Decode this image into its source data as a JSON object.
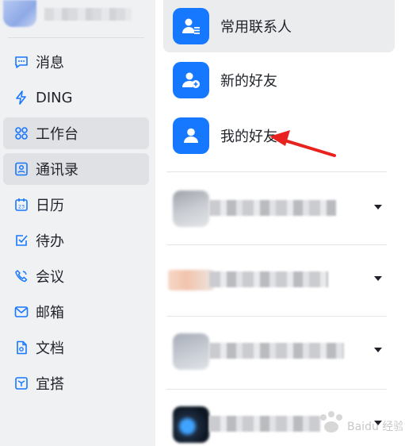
{
  "sidebar": {
    "items": [
      {
        "label": "消息",
        "icon": "chat-bubble-icon"
      },
      {
        "label": "DING",
        "icon": "lightning-icon"
      },
      {
        "label": "工作台",
        "icon": "grid-apps-icon"
      },
      {
        "label": "通讯录",
        "icon": "contacts-book-icon"
      },
      {
        "label": "日历",
        "icon": "calendar-icon",
        "icon_text": "23"
      },
      {
        "label": "待办",
        "icon": "checkbox-icon"
      },
      {
        "label": "会议",
        "icon": "phone-meeting-icon"
      },
      {
        "label": "邮箱",
        "icon": "mail-icon"
      },
      {
        "label": "文档",
        "icon": "document-icon"
      },
      {
        "label": "宜搭",
        "icon": "box-icon"
      }
    ]
  },
  "contacts": {
    "entries": [
      {
        "label": "常用联系人",
        "icon": "frequent-contacts-icon"
      },
      {
        "label": "新的好友",
        "icon": "add-friend-icon"
      },
      {
        "label": "我的好友",
        "icon": "my-friends-icon"
      }
    ]
  },
  "watermark": {
    "text": "Baidu 经验"
  },
  "colors": {
    "accent": "#1677ff",
    "arrow": "#e8231f",
    "sidebar_bg": "#f0f1f3",
    "active_bg": "#e0e1e5"
  }
}
